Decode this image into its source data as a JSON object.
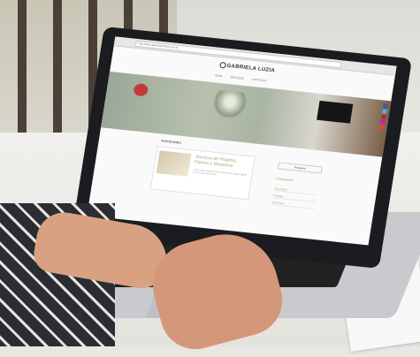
{
  "website": {
    "url": "http://www.gabrielaivictoria.com.br",
    "logo": "GABRIELA LUZIA",
    "nav": [
      "HOME",
      "SERVIÇOS",
      "PORTFÓLIO"
    ],
    "section_heading": "NOVIDADES",
    "post_title": "Serviços de Projetos, Pobres e Modernos",
    "post_excerpt": "Lorem ipsum dolor sit amet, consectetur adipiscing elit sed do eiusmod tempor",
    "search_label": "Pesquisar",
    "categories_heading": "Categorias",
    "categories": [
      "Decoração",
      "Projetos",
      "Reformas"
    ],
    "social_colors": [
      "#3b5998",
      "#55acee",
      "#cb2027",
      "#bc2a8d",
      "#dd4b39"
    ]
  }
}
